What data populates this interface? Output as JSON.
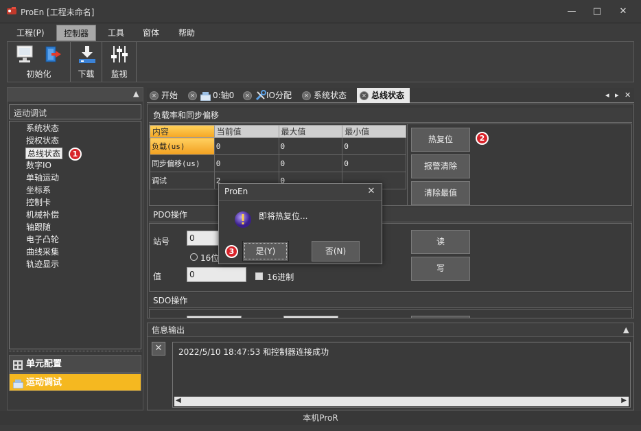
{
  "window": {
    "title": "ProEn [工程未命名]",
    "controls": [
      "minimize",
      "maximize",
      "close"
    ]
  },
  "menu": {
    "items": [
      {
        "label": "工程(P)",
        "active": false
      },
      {
        "label": "控制器",
        "active": true
      },
      {
        "label": "工具",
        "active": false
      },
      {
        "label": "窗体",
        "active": false
      },
      {
        "label": "帮助",
        "active": false
      }
    ]
  },
  "ribbon": {
    "groups": [
      {
        "label": "初始化",
        "icons": [
          "computer-icon",
          "exit-door-icon"
        ]
      },
      {
        "label": "下载",
        "icons": [
          "download-icon"
        ]
      },
      {
        "label": "监视",
        "icons": [
          "sliders-icon"
        ]
      }
    ]
  },
  "left_panel": {
    "pin": "pin-icon",
    "section_title": "运动调试",
    "tree": [
      {
        "label": "系统状态",
        "selected": false
      },
      {
        "label": "授权状态",
        "selected": false
      },
      {
        "label": "总线状态",
        "selected": true
      },
      {
        "label": "数字IO",
        "selected": false
      },
      {
        "label": "单轴运动",
        "selected": false
      },
      {
        "label": "坐标系",
        "selected": false
      },
      {
        "label": "控制卡",
        "selected": false
      },
      {
        "label": "机械补偿",
        "selected": false
      },
      {
        "label": "轴跟随",
        "selected": false
      },
      {
        "label": "电子凸轮",
        "selected": false
      },
      {
        "label": "曲线采集",
        "selected": false
      },
      {
        "label": "轨迹显示",
        "selected": false
      }
    ],
    "nav": [
      {
        "label": "单元配置",
        "active": false
      },
      {
        "label": "运动调试",
        "active": true
      }
    ]
  },
  "tabs": [
    {
      "label": "开始",
      "icon": "",
      "active": false
    },
    {
      "label": "0:轴0",
      "icon": "axis-icon",
      "active": false
    },
    {
      "label": "IO分配",
      "icon": "tools-icon",
      "active": false
    },
    {
      "label": "系统状态",
      "icon": "",
      "active": false
    },
    {
      "label": "总线状态",
      "icon": "",
      "active": true
    }
  ],
  "tab_controls": [
    "◂",
    "▸",
    "✕"
  ],
  "load_section": {
    "title": "负载率和同步偏移",
    "columns": [
      "内容",
      "当前值",
      "最大值",
      "最小值"
    ],
    "rows": [
      {
        "name": "负载(us)",
        "current": "0",
        "max": "0",
        "min": "0",
        "selected": true
      },
      {
        "name": "同步偏移(us)",
        "current": "0",
        "max": "0",
        "min": "0",
        "selected": false
      },
      {
        "name": "调试",
        "current": "2",
        "max": "0",
        "min": "",
        "selected": false
      }
    ],
    "buttons": {
      "hot_reset": "热复位",
      "clear_alarm": "报警清除",
      "clear_max": "清除最值"
    }
  },
  "pdo_section": {
    "title": "PDO操作",
    "station_label": "站号",
    "station_value": "0",
    "radio_16": "16位",
    "value_label": "值",
    "value_value": "0",
    "hex_label": "16进制",
    "read_button": "读",
    "write_button": "写"
  },
  "sdo_section": {
    "title": "SDO操作"
  },
  "info_output": {
    "title": "信息输出",
    "entries": [
      "2022/5/10   18:47:53 和控制器连接成功"
    ]
  },
  "status_bar": {
    "text": "本机ProR"
  },
  "dialog": {
    "title": "ProEn",
    "message": "即将热复位...",
    "yes_button": "是(Y)",
    "no_button": "否(N)"
  },
  "callouts": [
    "1",
    "2",
    "3"
  ],
  "colors": {
    "accent": "#f5a623",
    "badge": "#d8232a",
    "background": "#3c3c3c"
  }
}
